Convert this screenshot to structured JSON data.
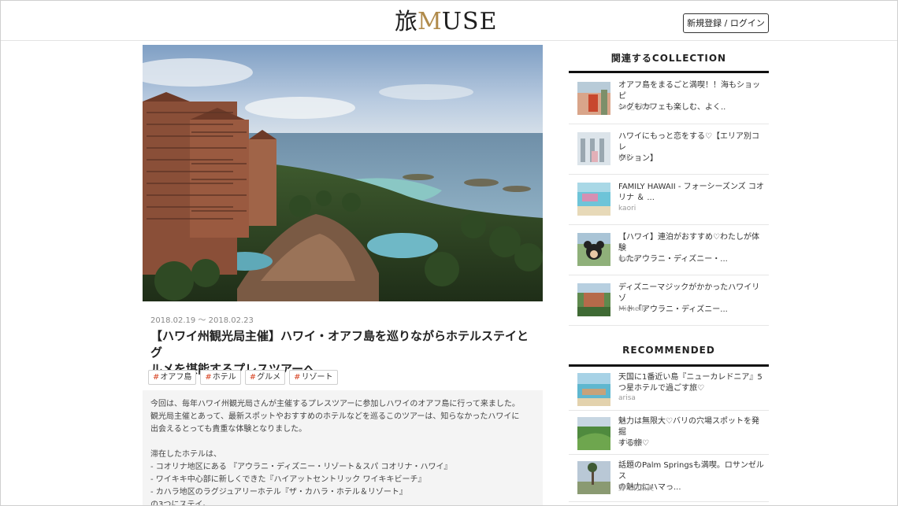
{
  "header": {
    "logo_kanji": "旅",
    "logo_m": "M",
    "logo_rest": "USE",
    "login_label": "新規登録 / ログイン"
  },
  "article": {
    "date": "2018.02.19 ～ 2018.02.23",
    "title_line1": "【ハワイ州観光局主催】ハワイ・オアフ島を巡りながらホテルステイとグ",
    "title_line2": "ルメを堪能するプレスツアーへ",
    "tags": [
      "オアフ島",
      "ホテル",
      "グルメ",
      "リゾート"
    ],
    "body": [
      "今回は、毎年ハワイ州観光局さんが主催するプレスツアーに参加しハワイのオアフ島に行って来ました。",
      "観光局主催とあって、最新スポットやおすすめのホテルなどを巡るこのツアーは、知らなかったハワイに",
      "出会えるとっても貴重な体験となりました。",
      "",
      "滞在したホテルは、",
      "- コオリナ地区にある 『アウラニ・ディズニー・リゾート＆スパ コオリナ・ハワイ』",
      "- ワイキキ中心部に新しくできた『ハイアットセントリック ワイキキビーチ』",
      "- カハラ地区のラグジュアリーホテル『ザ・カハラ・ホテル＆リゾート』",
      "の3つにステイ。"
    ]
  },
  "sidebar": {
    "collection_heading": "関連するCOLLECTION",
    "collection": [
      {
        "line1": "オアフ島をまるごと満喫！！海もショッピ",
        "line2": "ングもカフェも楽しむ、よく..",
        "user": "sao_0324"
      },
      {
        "line1": "ハワイにもっと恋をする♡【エリア別コレ",
        "line2": "クション】",
        "user": "Miki"
      },
      {
        "line1": "FAMILY HAWAII - フォーシーズンズ コオ",
        "line2": "リナ ＆ ...",
        "user": "kaori"
      },
      {
        "line1": "【ハワイ】連泊がおすすめ♡わたしが体験",
        "line2": "したアウラニ・ディズニー・...",
        "user": "moca"
      },
      {
        "line1": "ディズニーマジックがかかったハワイリゾ",
        "line2": "ート「アウラニ・ディズニー...",
        "user": "Michelle"
      }
    ],
    "recommended_heading": "RECOMMENDED",
    "recommended": [
      {
        "line1": "天国に1番近い島『ニューカレドニア』5",
        "line2": "つ星ホテルで過ごす旅♡",
        "user": "arisa"
      },
      {
        "line1": "魅力は無限大♡バリの穴場スポットを発掘",
        "line2": "する旅♡",
        "user": "arisam"
      },
      {
        "line1": "話題のPalm Springsも満喫。ロサンゼルス",
        "line2": "の魅力にハマっ...",
        "user": "野々村菜美"
      }
    ]
  },
  "colors": {
    "accent_gold": "#b08a4a",
    "tag_hash": "#d6401f"
  }
}
